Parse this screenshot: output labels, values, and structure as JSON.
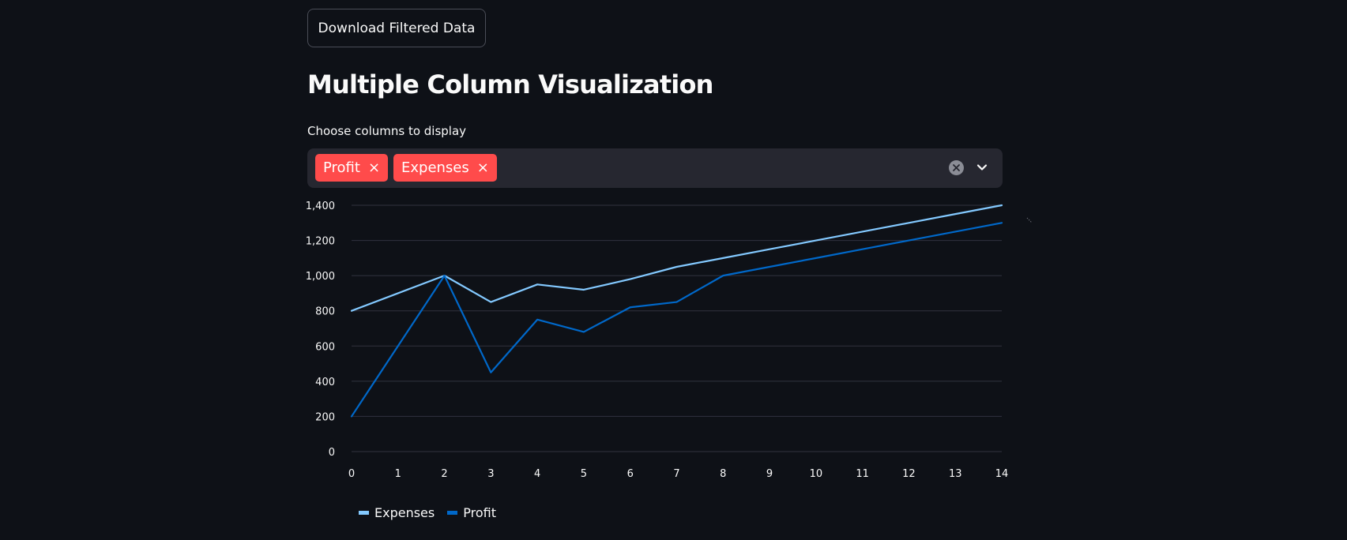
{
  "download_button": {
    "label": "Download Filtered Data"
  },
  "section": {
    "title": "Multiple Column Visualization"
  },
  "column_select": {
    "label": "Choose columns to display",
    "selected": [
      {
        "label": "Profit",
        "remove_symbol": "×"
      },
      {
        "label": "Expenses",
        "remove_symbol": "×"
      }
    ],
    "clear_icon": "clear-circle-icon",
    "dropdown_icon": "chevron-down-icon",
    "tag_color": "#ff4b4b"
  },
  "chart_data": {
    "type": "line",
    "x": [
      0,
      1,
      2,
      3,
      4,
      5,
      6,
      7,
      8,
      9,
      10,
      11,
      12,
      13,
      14
    ],
    "x_tick_labels": [
      "0",
      "1",
      "2",
      "3",
      "4",
      "5",
      "6",
      "7",
      "8",
      "9",
      "10",
      "11",
      "12",
      "13",
      "14"
    ],
    "y_tick_values": [
      0,
      200,
      400,
      600,
      800,
      1000,
      1200,
      1400
    ],
    "y_tick_labels": [
      "0",
      "200",
      "400",
      "600",
      "800",
      "1,000",
      "1,200",
      "1,400"
    ],
    "ylim": [
      0,
      1400
    ],
    "xlim": [
      0,
      14
    ],
    "grid": true,
    "legend_position": "bottom-left",
    "series": [
      {
        "name": "Expenses",
        "color": "#83c9ff",
        "values": [
          800,
          900,
          1000,
          850,
          950,
          920,
          980,
          1050,
          1100,
          1150,
          1200,
          1250,
          1300,
          1350,
          1400
        ]
      },
      {
        "name": "Profit",
        "color": "#0068c9",
        "values": [
          200,
          600,
          1000,
          450,
          750,
          680,
          820,
          850,
          1000,
          1050,
          1100,
          1150,
          1200,
          1250,
          1300
        ]
      }
    ],
    "legend": [
      {
        "name": "Expenses",
        "color": "#83c9ff"
      },
      {
        "name": "Profit",
        "color": "#0068c9"
      }
    ]
  }
}
